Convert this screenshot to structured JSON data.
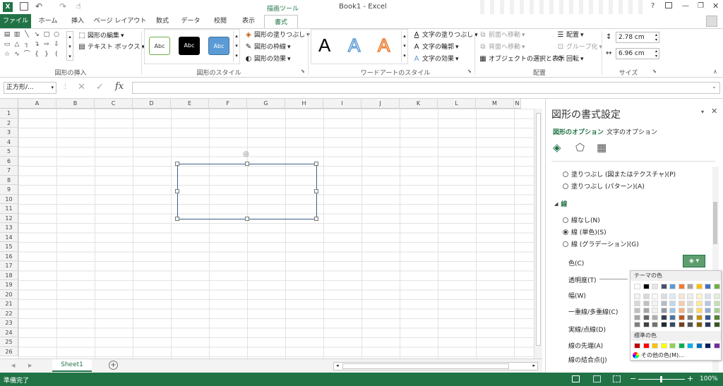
{
  "window": {
    "title": "Book1 - Excel",
    "context_tab_group": "描画ツール",
    "help": "?"
  },
  "tabs": [
    "ファイル",
    "ホーム",
    "挿入",
    "ページ レイアウト",
    "数式",
    "データ",
    "校閲",
    "表示",
    "書式"
  ],
  "ribbon": {
    "groups": {
      "insert_shapes": "図形の挿入",
      "shape_styles": "図形のスタイル",
      "wordart_styles": "ワードアートのスタイル",
      "arrange": "配置",
      "size": "サイズ"
    },
    "edit_shape": "図形の編集",
    "text_box": "テキスト ボックス",
    "style_sample": "Abc",
    "shape_fill": "図形の塗りつぶし",
    "shape_outline": "図形の枠線",
    "shape_effects": "図形の効果",
    "wordart_letter": "A",
    "text_fill": "文字の塗りつぶし",
    "text_outline": "文字の輪郭",
    "text_effects": "文字の効果",
    "bring_forward": "前面へ移動",
    "send_backward": "背面へ移動",
    "selection_pane": "オブジェクトの選択と表示",
    "align": "配置",
    "group": "グループ化",
    "rotate": "回転",
    "height": "2.78 cm",
    "width": "6.96 cm"
  },
  "formula_bar": {
    "name_box": "正方形/...",
    "fx": "fx",
    "value": ""
  },
  "sheet": {
    "columns": [
      "A",
      "B",
      "C",
      "D",
      "E",
      "F",
      "G",
      "H",
      "I",
      "J",
      "K",
      "L",
      "M",
      "N"
    ],
    "rows": [
      "1",
      "2",
      "3",
      "4",
      "5",
      "6",
      "7",
      "8",
      "9",
      "10",
      "11",
      "12",
      "13",
      "14",
      "15",
      "16",
      "17",
      "18",
      "19",
      "20",
      "21",
      "22",
      "23",
      "24",
      "25",
      "26"
    ],
    "tab": "Sheet1"
  },
  "status": {
    "ready": "準備完了",
    "zoom": "100%"
  },
  "pane": {
    "title": "図形の書式設定",
    "tab_shape": "図形のオプション",
    "tab_text": "文字のオプション",
    "fill_picture": "塗りつぶし (図またはテクスチャ)(P)",
    "fill_pattern": "塗りつぶし (パターン)(A)",
    "line_section": "線",
    "no_line": "線なし(N)",
    "solid_line": "線 (単色)(S)",
    "gradient_line": "線 (グラデーション)(G)",
    "color": "色(C)",
    "transparency": "透明度(T)",
    "width": "幅(W)",
    "compound": "一重線/多重線(C)",
    "dash": "実線/点線(D)",
    "cap": "線の先端(A)",
    "join": "線の結合点(J)"
  },
  "color_popup": {
    "theme_colors": "テーマの色",
    "standard_colors": "標準の色",
    "more_colors": "その他の色(M)...",
    "theme_top": [
      "#ffffff",
      "#000000",
      "#e7e6e6",
      "#44546a",
      "#5b9bd5",
      "#ed7d31",
      "#a5a5a5",
      "#ffc000",
      "#4472c4",
      "#70ad47"
    ],
    "standard": [
      "#c00000",
      "#ff0000",
      "#ffc000",
      "#ffff00",
      "#92d050",
      "#00b050",
      "#00b0f0",
      "#0070c0",
      "#002060",
      "#7030a0"
    ]
  },
  "colors": {
    "accent": "#217346",
    "outline_btn": "#5e9e6e"
  }
}
